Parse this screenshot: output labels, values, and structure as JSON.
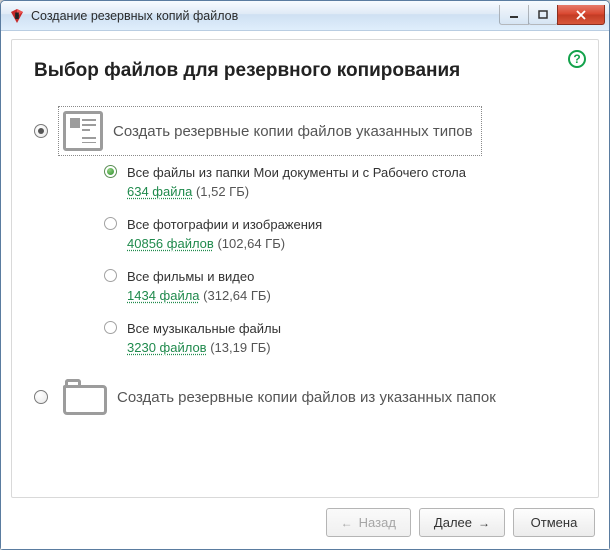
{
  "window": {
    "title": "Создание резервных копий файлов"
  },
  "page": {
    "heading": "Выбор файлов для резервного копирования",
    "help_tooltip": "?"
  },
  "options": {
    "by_type": {
      "label": "Создать резервные копии файлов указанных типов",
      "selected": true,
      "sub_selected_index": 0,
      "items": [
        {
          "label": "Все файлы из папки Мои документы и с Рабочего стола",
          "count_text": "634 файла",
          "size_text": "(1,52 ГБ)"
        },
        {
          "label": "Все фотографии и изображения",
          "count_text": "40856 файлов",
          "size_text": "(102,64 ГБ)"
        },
        {
          "label": "Все фильмы и видео",
          "count_text": "1434 файла",
          "size_text": "(312,64 ГБ)"
        },
        {
          "label": "Все музыкальные файлы",
          "count_text": "3230 файлов",
          "size_text": "(13,19 ГБ)"
        }
      ]
    },
    "by_folder": {
      "label": "Создать резервные копии файлов из указанных папок",
      "selected": false
    }
  },
  "footer": {
    "back": "Назад",
    "next": "Далее",
    "cancel": "Отмена"
  }
}
